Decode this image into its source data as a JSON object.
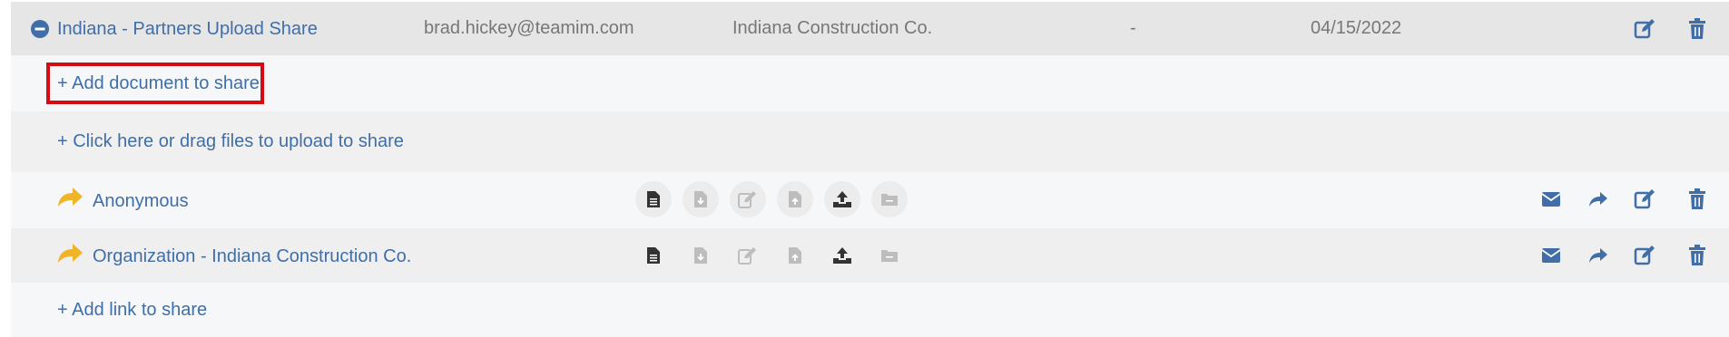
{
  "share": {
    "title": "Indiana - Partners Upload Share",
    "owner_email": "brad.hickey@teamim.com",
    "organization": "Indiana Construction Co.",
    "expiry": "-",
    "date": "04/15/2022"
  },
  "actions": {
    "add_document": "+ Add document to share",
    "upload_files": "+ Click here or drag files to upload to share",
    "add_link": "+ Add link to share"
  },
  "recipients": [
    {
      "name": "Anonymous"
    },
    {
      "name": "Organization - Indiana Construction Co."
    }
  ],
  "colors": {
    "accent": "#3f6ea8",
    "share_arrow": "#f0b429",
    "highlight_border": "#d40d12",
    "permission_active": "#333333",
    "permission_inactive": "#bdbdbd"
  }
}
